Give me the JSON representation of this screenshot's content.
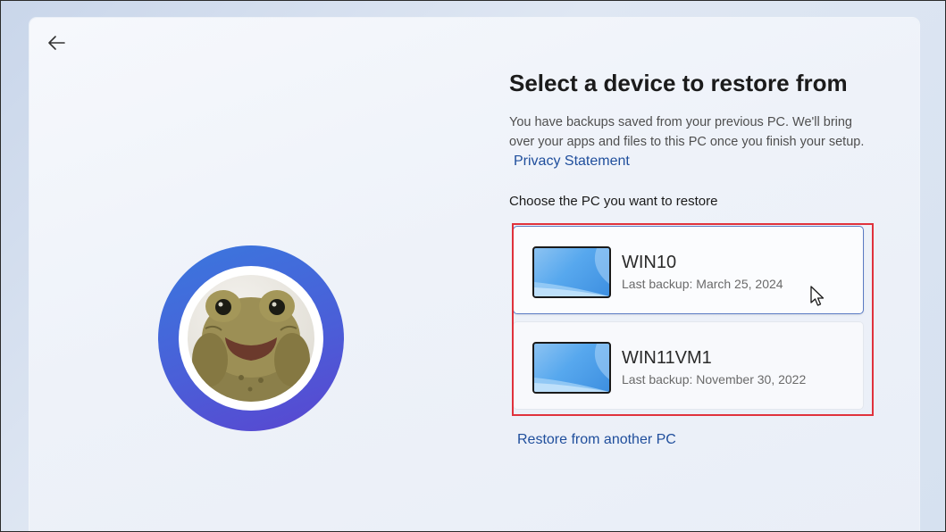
{
  "header": {
    "back_icon": "arrow-left-icon"
  },
  "profile": {
    "avatar_description": "avatar-photo",
    "ring_colors": [
      "#3a78de",
      "#5a45d0"
    ]
  },
  "main": {
    "title": "Select a device to restore from",
    "description": "You have backups saved from your previous PC. We'll bring over your apps and files to this PC once you finish your setup.",
    "privacy_link": "Privacy Statement",
    "choose_label": "Choose the PC you want to restore",
    "devices": [
      {
        "name": "WIN10",
        "last_backup": "Last backup: March 25, 2024",
        "selected": true
      },
      {
        "name": "WIN11VM1",
        "last_backup": "Last backup: November 30, 2022",
        "selected": false
      }
    ],
    "restore_other_link": "Restore from another PC"
  },
  "colors": {
    "link": "#1f4e9c",
    "highlight": "#e0323c",
    "selected_border": "#5b7bc4"
  }
}
